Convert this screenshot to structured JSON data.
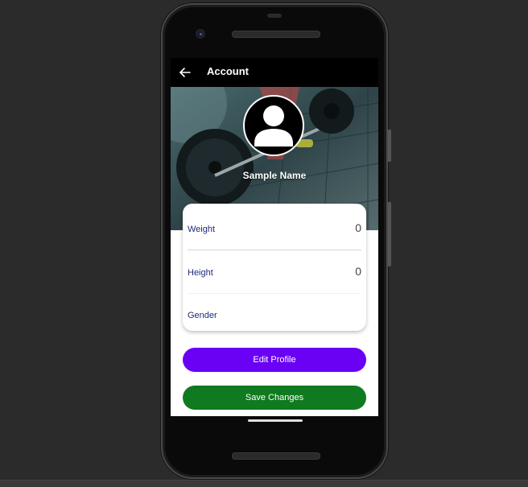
{
  "appbar": {
    "title": "Account",
    "back_icon": "arrow-left-icon"
  },
  "profile": {
    "avatar_icon": "person-icon",
    "name": "Sample Name"
  },
  "details": {
    "rows": [
      {
        "label": "Weight",
        "value": "0"
      },
      {
        "label": "Height",
        "value": "0"
      },
      {
        "label": "Gender",
        "value": ""
      }
    ]
  },
  "actions": {
    "edit_label": "Edit Profile",
    "save_label": "Save Changes"
  },
  "colors": {
    "appbar_bg": "#000000",
    "edit_button": "#6a00f4",
    "save_button": "#0f7a1f",
    "label_text": "#1e2a78"
  }
}
